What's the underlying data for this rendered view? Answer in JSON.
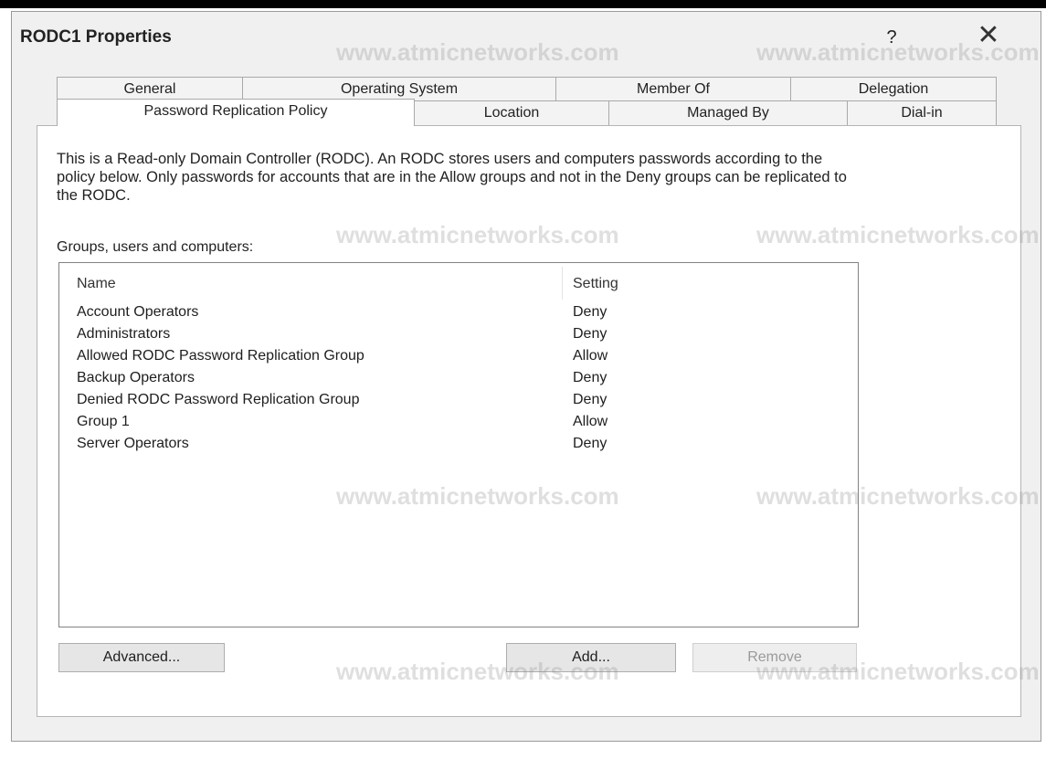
{
  "dialog": {
    "title": "RODC1 Properties",
    "help_label": "?",
    "close_label": "✕"
  },
  "tabs": {
    "top_row": [
      "General",
      "Operating System",
      "Member Of",
      "Delegation"
    ],
    "bottom_row": [
      "Password Replication Policy",
      "Location",
      "Managed By",
      "Dial-in"
    ],
    "active": "Password Replication Policy"
  },
  "policy": {
    "description": "This is a Read-only Domain Controller (RODC).  An RODC stores users and computers passwords according to the policy below.  Only passwords for accounts that are in the Allow groups and not in the Deny groups can be replicated to the RODC.",
    "groups_label": "Groups, users and computers:",
    "columns": {
      "name": "Name",
      "setting": "Setting"
    },
    "rows": [
      {
        "name": "Account Operators",
        "setting": "Deny"
      },
      {
        "name": "Administrators",
        "setting": "Deny"
      },
      {
        "name": "Allowed RODC Password Replication Group",
        "setting": "Allow"
      },
      {
        "name": "Backup Operators",
        "setting": "Deny"
      },
      {
        "name": "Denied RODC Password Replication Group",
        "setting": "Deny"
      },
      {
        "name": "Group 1",
        "setting": "Allow"
      },
      {
        "name": "Server Operators",
        "setting": "Deny"
      }
    ]
  },
  "buttons": {
    "advanced": "Advanced...",
    "add": "Add...",
    "remove": "Remove"
  },
  "watermark_text": "www.atmicnetworks.com"
}
